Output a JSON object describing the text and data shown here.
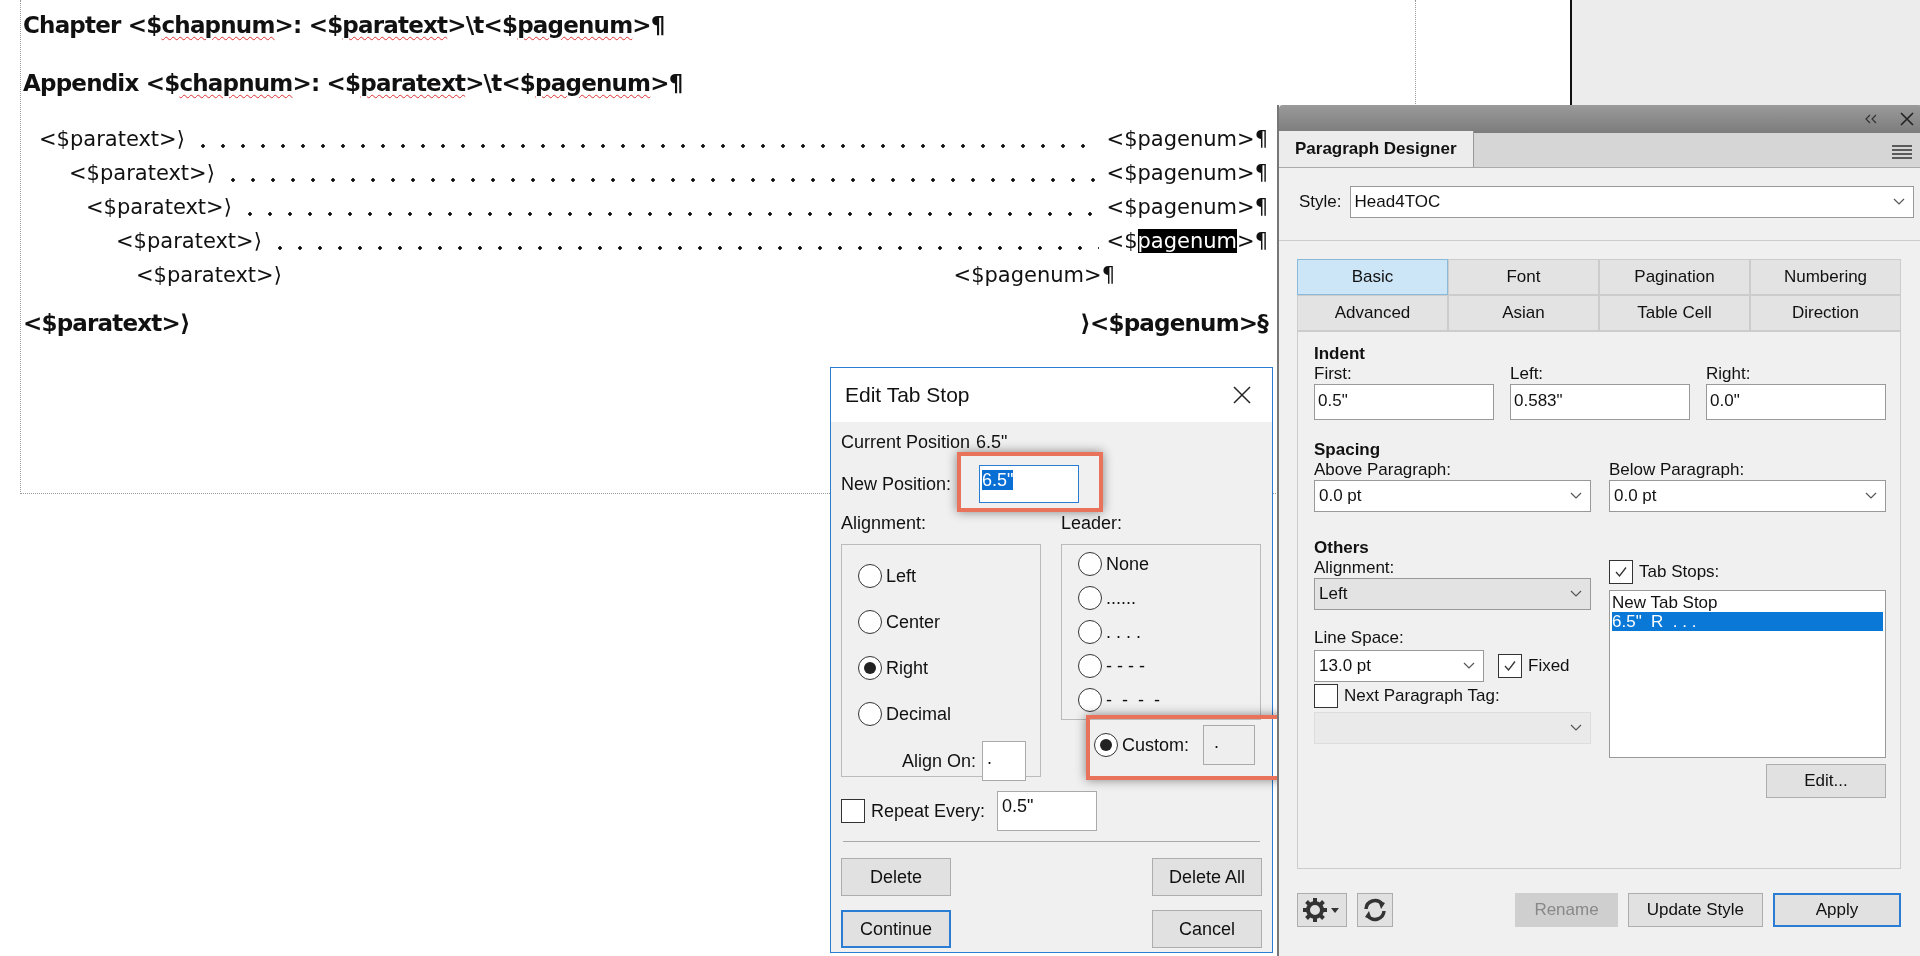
{
  "document": {
    "lines": [
      {
        "kind": "heading",
        "segments": [
          {
            "text": "Chapter <$",
            "misspelled": false
          },
          {
            "text": "chapnum",
            "misspelled": true
          },
          {
            "text": ">: <$",
            "misspelled": false
          },
          {
            "text": "paratext",
            "misspelled": true
          },
          {
            "text": ">\\t<$",
            "misspelled": false
          },
          {
            "text": "pagenum",
            "misspelled": true
          },
          {
            "text": ">¶",
            "misspelled": false
          }
        ]
      },
      {
        "kind": "heading",
        "segments": [
          {
            "text": "Appendix <$",
            "misspelled": false
          },
          {
            "text": "chapnum",
            "misspelled": true
          },
          {
            "text": ">: <$",
            "misspelled": false
          },
          {
            "text": "paratext",
            "misspelled": true
          },
          {
            "text": ">\\t<$",
            "misspelled": false
          },
          {
            "text": "pagenum",
            "misspelled": true
          },
          {
            "text": ">¶",
            "misspelled": false
          }
        ]
      },
      {
        "kind": "toc",
        "entry": {
          "left": "<$paratext>⟩",
          "dot_leader": true,
          "right": [
            {
              "text": "<$pagenum>¶",
              "selected": false
            }
          ],
          "children": [
            {
              "left": "<$paratext>⟩",
              "dot_leader": true,
              "right": [
                {
                  "text": "<$pagenum>¶",
                  "selected": false
                }
              ],
              "children": [
                {
                  "left": "<$paratext>⟩",
                  "dot_leader": true,
                  "right": [
                    {
                      "text": "<$pagenum>¶",
                      "selected": false
                    }
                  ],
                  "children": [
                    {
                      "left": "<$paratext>⟩",
                      "dot_leader": true,
                      "right": [
                        {
                          "text": "<$",
                          "selected": false
                        },
                        {
                          "text": "pagenum",
                          "selected": true
                        },
                        {
                          "text": ">¶",
                          "selected": false
                        }
                      ],
                      "children": [
                        {
                          "left": "<$paratext>⟩",
                          "dot_leader": false,
                          "right": [
                            {
                              "text": "<$pagenum>¶",
                              "selected": false
                            }
                          ]
                        }
                      ]
                    }
                  ]
                }
              ]
            }
          ]
        }
      },
      {
        "kind": "split",
        "left": "<$paratext>⟩",
        "right": "⟩<$pagenum>§"
      }
    ]
  },
  "dialog": {
    "title": "Edit Tab Stop",
    "current_position": {
      "label": "Current Position",
      "value": "6.5\""
    },
    "new_position": {
      "label": "New Position:",
      "value": "6.5\"",
      "value_selected": true,
      "highlighted": true
    },
    "alignment": {
      "label": "Alignment:",
      "options": [
        {
          "label": "Left",
          "selected": false
        },
        {
          "label": "Center",
          "selected": false
        },
        {
          "label": "Right",
          "selected": true
        },
        {
          "label": "Decimal",
          "selected": false
        }
      ],
      "align_on": {
        "label": "Align On:",
        "value": "."
      }
    },
    "leader": {
      "label": "Leader:",
      "options": [
        {
          "label": "None",
          "selected": false
        },
        {
          "label": "......",
          "selected": false
        },
        {
          "label": ". . . .",
          "selected": false
        },
        {
          "label": "- - - -",
          "selected": false
        },
        {
          "label": "-  -  -  -",
          "selected": false
        }
      ],
      "custom": {
        "label": "Custom:",
        "value": ".",
        "selected": true,
        "highlighted": true
      }
    },
    "repeat_every": {
      "label": "Repeat Every:",
      "checked": false,
      "value": "0.5\""
    },
    "buttons": [
      {
        "label": "Delete",
        "default": false
      },
      {
        "label": "Delete All",
        "default": false
      },
      {
        "label": "Continue",
        "default": true
      },
      {
        "label": "Cancel",
        "default": false
      }
    ]
  },
  "panel": {
    "tab": "Paragraph Designer",
    "style": {
      "label": "Style:",
      "value": "Head4TOC"
    },
    "tabs": [
      {
        "label": "Basic",
        "selected": true
      },
      {
        "label": "Font",
        "selected": false
      },
      {
        "label": "Pagination",
        "selected": false
      },
      {
        "label": "Numbering",
        "selected": false
      },
      {
        "label": "Advanced",
        "selected": false
      },
      {
        "label": "Asian",
        "selected": false
      },
      {
        "label": "Table Cell",
        "selected": false
      },
      {
        "label": "Direction",
        "selected": false
      }
    ],
    "indent": {
      "title": "Indent",
      "fields": [
        {
          "label": "First:",
          "value": "0.5\""
        },
        {
          "label": "Left:",
          "value": "0.583\""
        },
        {
          "label": "Right:",
          "value": "0.0\""
        }
      ]
    },
    "spacing": {
      "title": "Spacing",
      "fields": [
        {
          "label": "Above Paragraph:",
          "value": "0.0 pt"
        },
        {
          "label": "Below Paragraph:",
          "value": "0.0 pt"
        }
      ]
    },
    "others": {
      "title": "Others",
      "alignment": {
        "label": "Alignment:",
        "value": "Left"
      },
      "line_space": {
        "label": "Line Space:",
        "value": "13.0 pt"
      },
      "fixed": {
        "label": "Fixed",
        "checked": true
      },
      "next_paragraph_tag": {
        "label": "Next Paragraph Tag:",
        "checked": false
      },
      "tab_stops": {
        "label": "Tab Stops:",
        "checked": true,
        "items": [
          {
            "label": "New Tab Stop",
            "selected": false
          },
          {
            "label": "6.5\"  R  . . .",
            "selected": true
          }
        ],
        "edit_button": "Edit..."
      }
    },
    "buttons": [
      {
        "label": "Rename",
        "disabled": true,
        "default": false
      },
      {
        "label": "Update Style",
        "disabled": false,
        "default": false
      },
      {
        "label": "Apply",
        "disabled": false,
        "default": true
      }
    ]
  }
}
